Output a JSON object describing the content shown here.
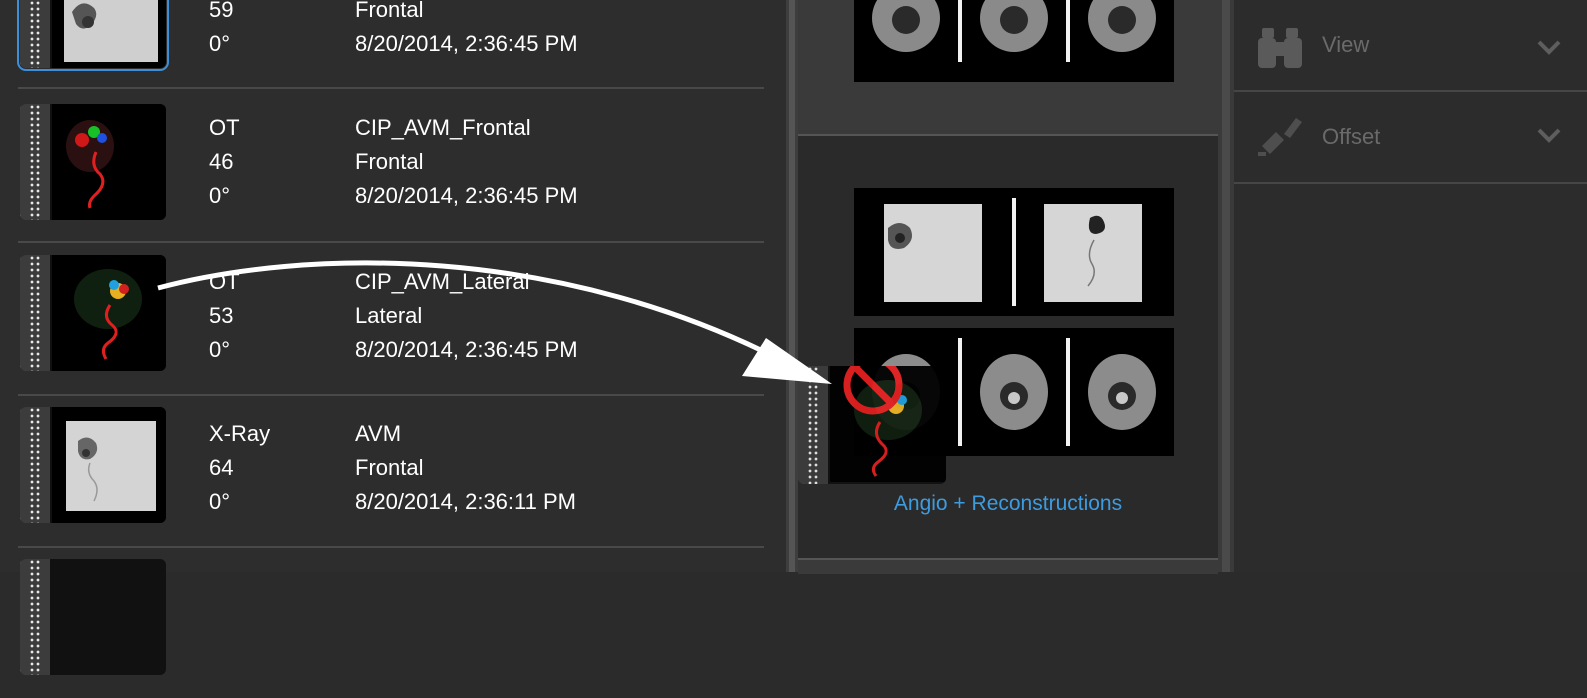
{
  "series_list": [
    {
      "modality": "",
      "images": "59",
      "name": "Frontal",
      "angle": "0°",
      "date": "8/20/2014, 2:36:45 PM",
      "selected": true
    },
    {
      "modality": "OT",
      "images": "46",
      "name": "CIP_AVM_Frontal",
      "view": "Frontal",
      "angle": "0°",
      "date": "8/20/2014, 2:36:45 PM"
    },
    {
      "modality": "OT",
      "images": "53",
      "name": "CIP_AVM_Lateral",
      "view": "Lateral",
      "angle": "0°",
      "date": "8/20/2014, 2:36:45 PM"
    },
    {
      "modality": "X-Ray",
      "images": "64",
      "name": "AVM",
      "view": "Frontal",
      "angle": "0°",
      "date": "8/20/2014, 2:36:11 PM"
    }
  ],
  "layout_panel": {
    "caption": "Angio + Reconstructions"
  },
  "tools": [
    {
      "label": "View",
      "icon": "binoculars-icon"
    },
    {
      "label": "Offset",
      "icon": "offset-icon"
    }
  ],
  "colors": {
    "accent": "#3d9be0",
    "selection": "#3d8fd8",
    "no_drop": "#e32020"
  }
}
